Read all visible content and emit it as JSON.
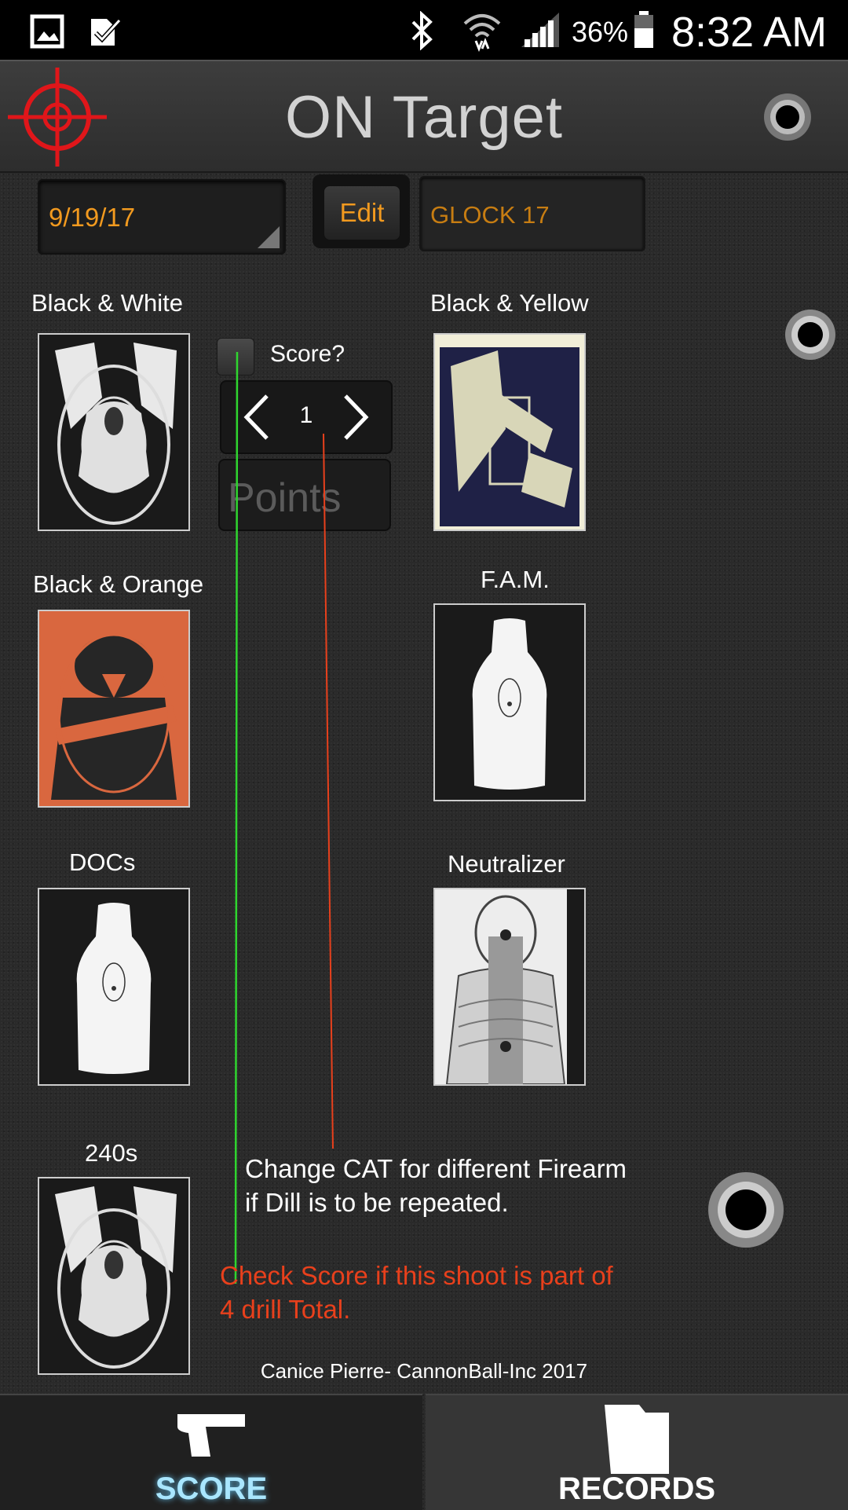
{
  "status_bar": {
    "battery_percent": "36%",
    "time": "8:32 AM"
  },
  "header": {
    "title": "ON Target"
  },
  "form": {
    "date": "9/19/17",
    "edit_label": "Edit",
    "firearm": "GLOCK 17"
  },
  "score_controls": {
    "score_label": "Score?",
    "stepper_value": "1",
    "points_placeholder": "Points"
  },
  "targets": [
    {
      "label": "Black & White"
    },
    {
      "label": "Black & Yellow"
    },
    {
      "label": "Black & Orange"
    },
    {
      "label": "F.A.M."
    },
    {
      "label": "DOCs"
    },
    {
      "label": "Neutralizer"
    },
    {
      "label": "240s"
    }
  ],
  "annotations": {
    "white_line1": "Change CAT for different Firearm",
    "white_line2": "if Dill is to be repeated.",
    "red_line1": "Check Score if this shoot is part of",
    "red_line2": "4 drill Total."
  },
  "credit": "Canice Pierre- CannonBall-Inc 2017",
  "nav": {
    "score": "SCORE",
    "records": "RECORDS"
  },
  "colors": {
    "accent_orange": "#f29a1f",
    "annotation_red": "#e8401c",
    "annotation_green": "#2fd62f",
    "nav_active": "#a9e6ff"
  }
}
